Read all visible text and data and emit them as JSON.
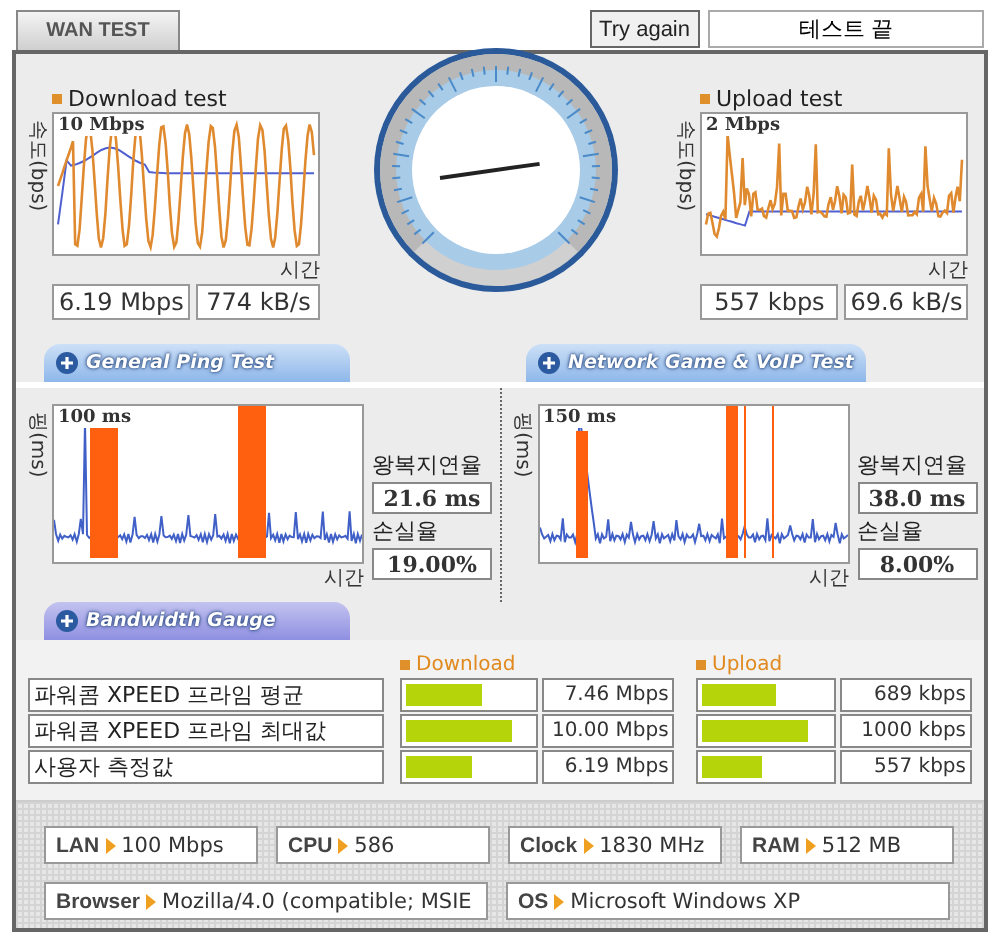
{
  "tabs": [
    {
      "label": "WAN TEST",
      "selected": true
    }
  ],
  "try_again_button": "Try again",
  "status": "테스트 끝",
  "download_test": {
    "legend": "Download test",
    "ylabel": "속도(bps)",
    "top_label": "10 Mbps",
    "xlabel": "시간",
    "readings": [
      "6.19 Mbps",
      "774 kB/s"
    ]
  },
  "upload_test": {
    "legend": "Upload test",
    "ylabel": "속도(bps)",
    "top_label": "2 Mbps",
    "xlabel": "시간",
    "readings": [
      "557 kbps",
      "69.6 kB/s"
    ]
  },
  "section_tabs": [
    "General Ping Test",
    "Network Game & VoIP Test"
  ],
  "ping_tests": [
    {
      "ylabel": "핑(ms)",
      "top_label": "100 ms",
      "xlabel": "시간",
      "latency_label": "왕복지연율",
      "latency": "21.6 ms",
      "loss_label": "손실율",
      "loss": "19.00%"
    },
    {
      "ylabel": "핑(ms)",
      "top_label": "150 ms",
      "xlabel": "시간",
      "latency_label": "왕복지연율",
      "latency": "38.0 ms",
      "loss_label": "손실율",
      "loss": "8.00%"
    }
  ],
  "bandwidth": {
    "tab": "Bandwidth Gauge",
    "download_header": "Download",
    "upload_header": "Upload",
    "rows": [
      {
        "label": "파워콤 XPEED 프라임 평균",
        "download": {
          "level": 0.6,
          "value": "7.46 Mbps"
        },
        "upload": {
          "level": 0.57,
          "value": "689 kbps"
        }
      },
      {
        "label": "파워콤 XPEED 프라임 최대값",
        "download": {
          "level": 0.83,
          "value": "10.00 Mbps"
        },
        "upload": {
          "level": 0.83,
          "value": "1000 kbps"
        }
      },
      {
        "label": "사용자 측정값",
        "download": {
          "level": 0.52,
          "value": "6.19 Mbps"
        },
        "upload": {
          "level": 0.46,
          "value": "557 kbps"
        }
      }
    ]
  },
  "system_info": [
    [
      {
        "label": "LAN",
        "value": "100 Mbps"
      },
      {
        "label": "CPU",
        "value": "586"
      },
      {
        "label": "Clock",
        "value": "1830 MHz"
      },
      {
        "label": "RAM",
        "value": "512 MB"
      }
    ],
    [
      {
        "label": "Browser",
        "value": "Mozilla/4.0 (compatible; MSIE"
      },
      {
        "label": "OS",
        "value": "Microsoft Windows XP"
      }
    ]
  ]
}
